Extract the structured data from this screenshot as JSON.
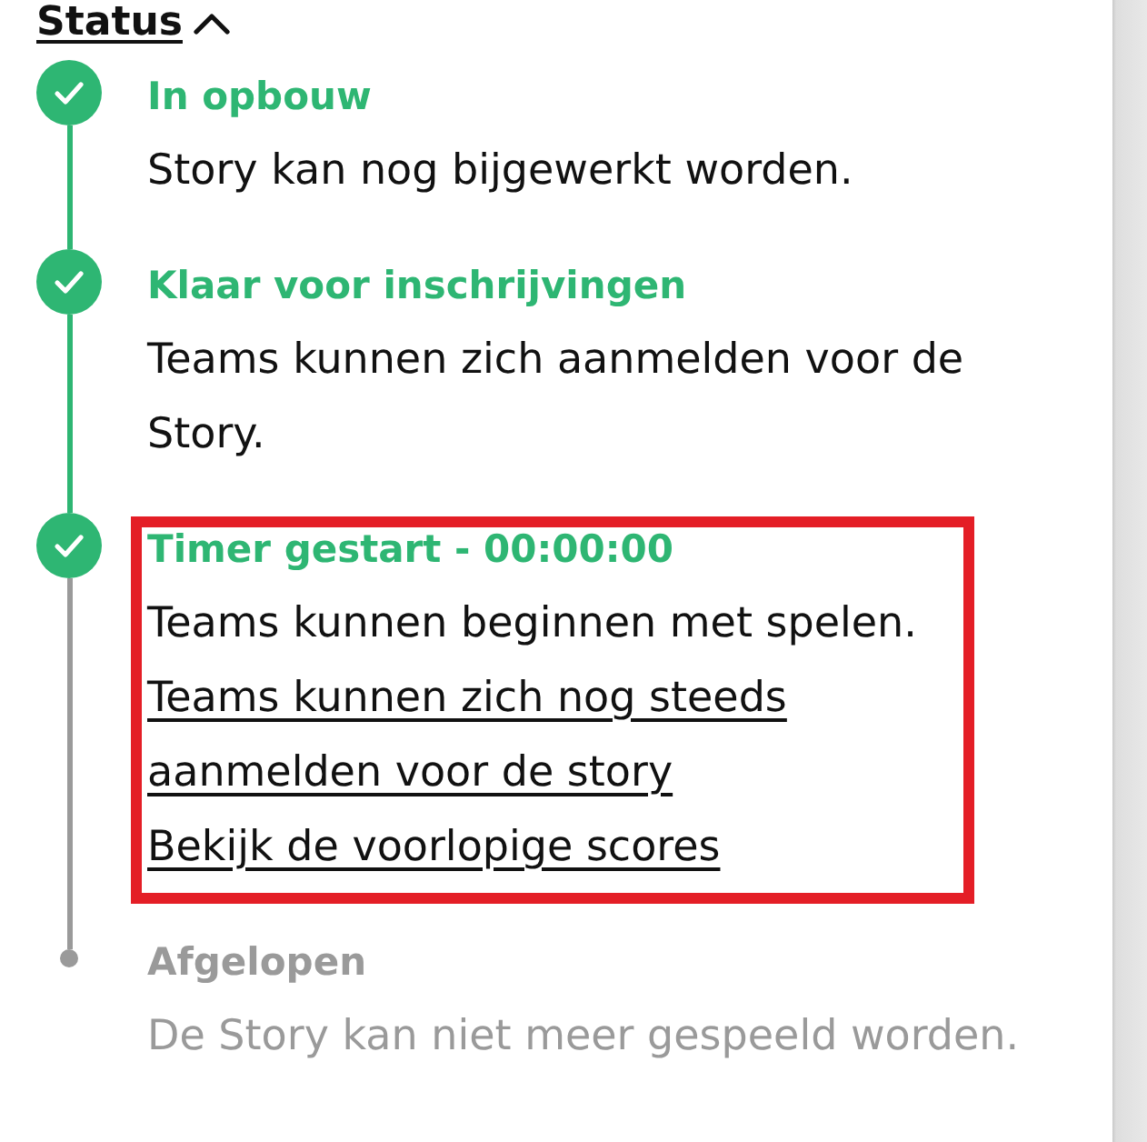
{
  "section": {
    "title": "Status",
    "expanded": true
  },
  "steps": [
    {
      "completed": true,
      "title": "In opbouw",
      "description": "Story kan nog bijgewerkt worden.",
      "highlighted": false
    },
    {
      "completed": true,
      "title": "Klaar voor inschrijvingen",
      "description": "Teams kunnen zich aanmelden voor de Story.",
      "highlighted": false
    },
    {
      "completed": true,
      "title": "Timer gestart - 00:00:00",
      "description": "Teams kunnen beginnen met spelen.",
      "links": [
        "Teams kunnen zich nog steeds aanmelden voor de story",
        "Bekijk de voorlopige scores"
      ],
      "highlighted": true
    },
    {
      "completed": false,
      "title": "Afgelopen",
      "description": "De Story kan niet meer gespeeld worden.",
      "highlighted": false
    }
  ]
}
